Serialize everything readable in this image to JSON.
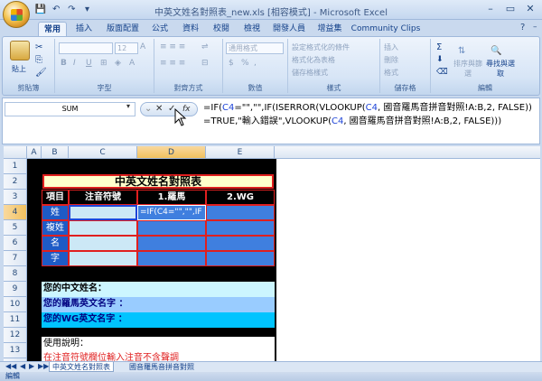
{
  "window": {
    "title": "中英文姓名對照表_new.xls [相容模式] - Microsoft Excel",
    "minimize": "–",
    "restore": "▭",
    "close": "✕"
  },
  "qat": [
    "save-icon",
    "undo-icon",
    "redo-icon",
    "customize-icon"
  ],
  "tabs": [
    "常用",
    "插入",
    "版面配置",
    "公式",
    "資料",
    "校閱",
    "檢視",
    "開發人員",
    "增益集",
    "Community Clips"
  ],
  "ribbon": {
    "clipboard": {
      "label": "剪貼簿",
      "paste": "貼上"
    },
    "font": {
      "label": "字型",
      "size": "12",
      "bold": "B",
      "italic": "I",
      "underline": "U"
    },
    "alignment": {
      "label": "對齊方式"
    },
    "number": {
      "label": "數值",
      "format": "通用格式",
      "percent": "%",
      "comma": ","
    },
    "styles": {
      "label": "樣式",
      "conditional": "設定格式化的條件",
      "as_table": "格式化為表格",
      "cell_styles": "儲存格樣式"
    },
    "cells": {
      "label": "儲存格",
      "insert": "插入",
      "delete": "刪除",
      "format": "格式"
    },
    "editing": {
      "label": "編輯",
      "sort": "排序與篩選",
      "find": "尋找與選取"
    }
  },
  "formula_bar": {
    "name_box": "SUM",
    "cancel": "✕",
    "enter": "✓",
    "fx": "fx",
    "formula_parts": [
      {
        "text": "=IF(",
        "c": ""
      },
      {
        "text": "C4",
        "c": "blue"
      },
      {
        "text": "=\"\",\"\",IF(ISERROR(VLOOKUP(",
        "c": ""
      },
      {
        "text": "C4",
        "c": "blue"
      },
      {
        "text": ", 國音羅馬音拼音對照!A:B,2, FALSE))=TRUE,\"輸入錯誤\",VLOOKUP(",
        "c": ""
      },
      {
        "text": "C4",
        "c": "blue"
      },
      {
        "text": ", 國音羅馬音拼音對照!A:B,2, FALSE)))",
        "c": ""
      }
    ]
  },
  "grid": {
    "columns": [
      "A",
      "B",
      "C",
      "D",
      "E"
    ],
    "rows": [
      "1",
      "2",
      "3",
      "4",
      "5",
      "6",
      "7",
      "8",
      "9",
      "10",
      "11",
      "12",
      "13",
      "14"
    ],
    "title": "中英文姓名對照表",
    "headers": [
      "項目",
      "注音符號",
      "1.羅馬",
      "2.WG"
    ],
    "items": [
      "姓",
      "複姓",
      "名",
      "字"
    ],
    "editing_cell": "=IF(C4=\"\",\"\",IF",
    "your_chinese_name": "您的中文姓名：",
    "your_roman_name": "您的羅馬英文名字 ：",
    "your_wg_name": "您的WG英文名字 ：",
    "instructions": "使用說明：",
    "instruction_line": "在注音符號欄位輸入注音不含聲調"
  },
  "sheet_tabs": [
    "中英文姓名對照表",
    "國音羅馬音拼音對照"
  ],
  "status": {
    "mode": "編輯"
  },
  "colors": {
    "table_title_bg": "#ffffcc",
    "header_bg": "#000000",
    "item_bg": "#1e5bc6",
    "input_bg": "#cce8f6",
    "output_bg": "#3f7fdf",
    "grid_red": "#e01f1f",
    "name_row_1": "#ccf6ff",
    "name_row_2": "#99ccff",
    "name_row_3": "#00c4ff"
  }
}
